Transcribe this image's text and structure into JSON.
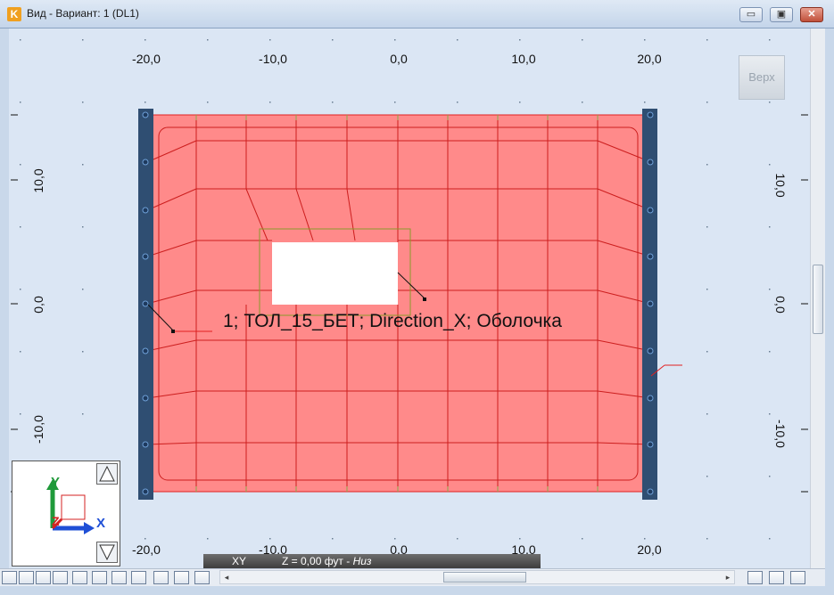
{
  "window": {
    "title": "Вид - Вариант: 1 (DL1)",
    "app_icon": "K",
    "minimize_glyph": "▭",
    "maximize_glyph": "▣",
    "close_glyph": "✕"
  },
  "ruler": {
    "top_labels": [
      "-20,0",
      "-10,0",
      "0,0",
      "10,0",
      "20,0"
    ],
    "bottom_labels": [
      "-20,0",
      "-10,0",
      "0,0",
      "10,0",
      "20,0"
    ],
    "left_labels": [
      "10,0",
      "0,0",
      "-10,0"
    ],
    "right_labels": [
      "10,0",
      "0,0",
      "-10,0"
    ]
  },
  "view_cube": {
    "label": "Верх"
  },
  "element_label": "1; ТОЛ_15_БЕТ; Direction_X; Оболочка",
  "axes": {
    "y_label": "Y",
    "x_label": "X",
    "z_label": "Z",
    "colors": {
      "x": "#1f4fd6",
      "y": "#1f9a3a",
      "z": "#d62020"
    }
  },
  "status": {
    "plane": "XY",
    "z_prefix": "Z = 0,00 фут - ",
    "z_side": "Низ"
  },
  "colors": {
    "slab_fill": "#ff8a8a",
    "slab_edge": "#e22020",
    "mesh_line": "#cc1e1e",
    "grid_tick": "#8aa84a",
    "wall": "#2f4e72",
    "background": "#dbe6f4"
  },
  "toolbar_icons": [
    "node-icon",
    "support-icon",
    "line-icon",
    "surface-icon",
    "load-icon",
    "pencil-icon",
    "axis-icon",
    "slab-icon",
    "rename-icon",
    "number-icon",
    "grid-icon"
  ],
  "right_toolbar_icons": [
    "delete-icon",
    "link-icon",
    "eye-icon"
  ]
}
